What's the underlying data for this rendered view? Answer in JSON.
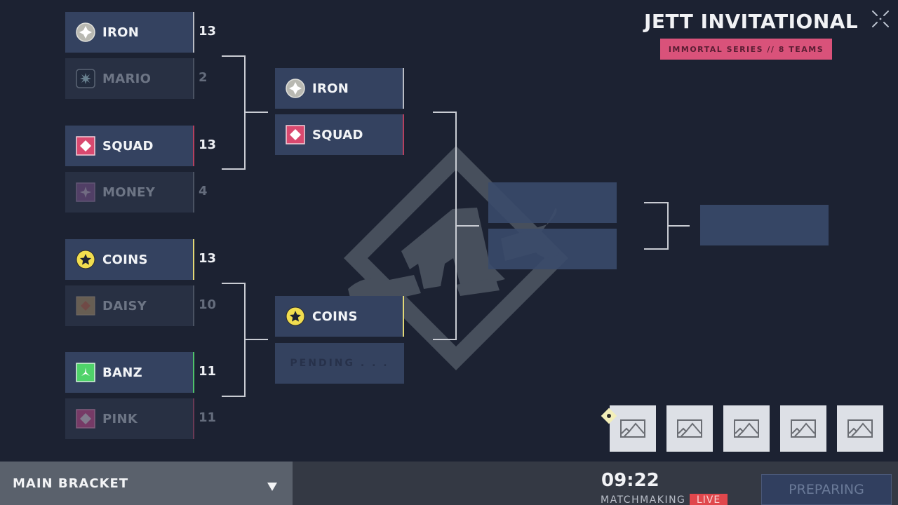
{
  "header": {
    "title": "JETT INVITATIONAL",
    "subtitle": "IMMORTAL SERIES  //  8 TEAMS"
  },
  "colors": {
    "background": "#1c2232",
    "accent_pink": "#d9527a",
    "live_red": "#e0474c"
  },
  "bracket": {
    "round1": [
      {
        "team_a": {
          "name": "IRON",
          "score": "13",
          "icon": "iron-crest-icon",
          "color": "#b9b9b2",
          "winner": true
        },
        "team_b": {
          "name": "MARIO",
          "score": "2",
          "icon": "mario-burst-icon",
          "color": "#1e2838",
          "winner": false
        }
      },
      {
        "team_a": {
          "name": "SQUAD",
          "score": "13",
          "icon": "squad-diamond-icon",
          "color": "#d9496f",
          "winner": true
        },
        "team_b": {
          "name": "MONEY",
          "score": "4",
          "icon": "money-star-icon",
          "color": "#7a4e8a",
          "winner": false
        }
      },
      {
        "team_a": {
          "name": "COINS",
          "score": "13",
          "icon": "coins-star-icon",
          "color": "#f1dd4f",
          "winner": true
        },
        "team_b": {
          "name": "DAISY",
          "score": "10",
          "icon": "daisy-diamond-icon",
          "color": "#a68d64",
          "winner": false
        }
      },
      {
        "team_a": {
          "name": "BANZ",
          "score": "11",
          "icon": "banz-tri-icon",
          "color": "#4fd36a",
          "winner": true
        },
        "team_b": {
          "name": "PINK",
          "score": "11",
          "icon": "pink-diamond-icon",
          "color": "#c4448a",
          "winner": false
        }
      }
    ],
    "round2": [
      {
        "team_a": {
          "name": "IRON",
          "icon": "iron-crest-icon"
        },
        "team_b": {
          "name": "SQUAD",
          "icon": "squad-diamond-icon"
        }
      },
      {
        "team_a": {
          "name": "COINS",
          "icon": "coins-star-icon"
        },
        "team_b": {
          "pending_label": "PENDING . . ."
        }
      }
    ]
  },
  "thumbnails": [
    {
      "icon": "image-placeholder-icon",
      "selected": true
    },
    {
      "icon": "image-placeholder-icon",
      "selected": false
    },
    {
      "icon": "image-placeholder-icon",
      "selected": false
    },
    {
      "icon": "image-placeholder-icon",
      "selected": false
    },
    {
      "icon": "image-placeholder-icon",
      "selected": false
    }
  ],
  "footer": {
    "bracket_select": "MAIN BRACKET",
    "timer": "09:22",
    "status_label": "MATCHMAKING",
    "live_badge": "LIVE",
    "action_button": "PREPARING"
  }
}
